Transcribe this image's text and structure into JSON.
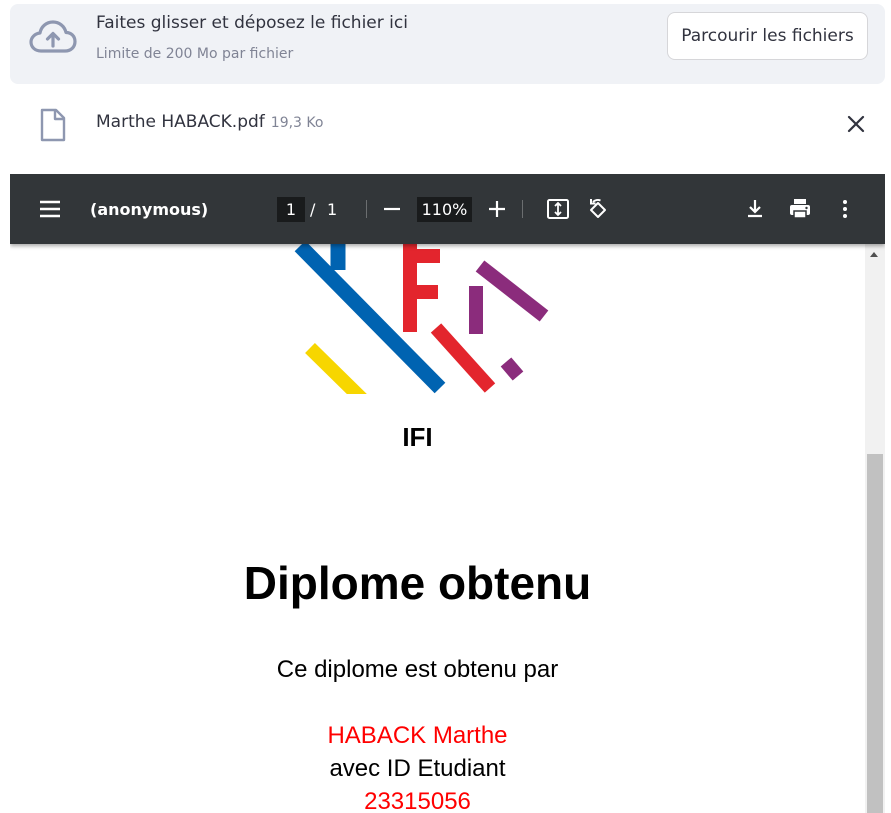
{
  "uploader": {
    "dropzone_title": "Faites glisser et déposez le fichier ici",
    "dropzone_limit": "Limite de 200 Mo par fichier",
    "browse_label": "Parcourir les fichiers",
    "icon": "cloud-upload-icon"
  },
  "file": {
    "name": "Marthe HABACK.pdf",
    "size": "19,3 Ko",
    "icon": "file-icon",
    "close_icon": "close-icon"
  },
  "viewer": {
    "title": "(anonymous)",
    "current_page": "1",
    "page_separator": "/",
    "total_pages": "1",
    "zoom": "110%",
    "toolbar_color": "#323639"
  },
  "document": {
    "logo_text": "IFI",
    "title": "Diplome obtenu",
    "intro": "Ce diplome est obtenu par",
    "student_name": "HABACK Marthe",
    "id_label": "avec ID Etudiant",
    "student_id": "23315056",
    "highlight_color": "#ff0000"
  }
}
